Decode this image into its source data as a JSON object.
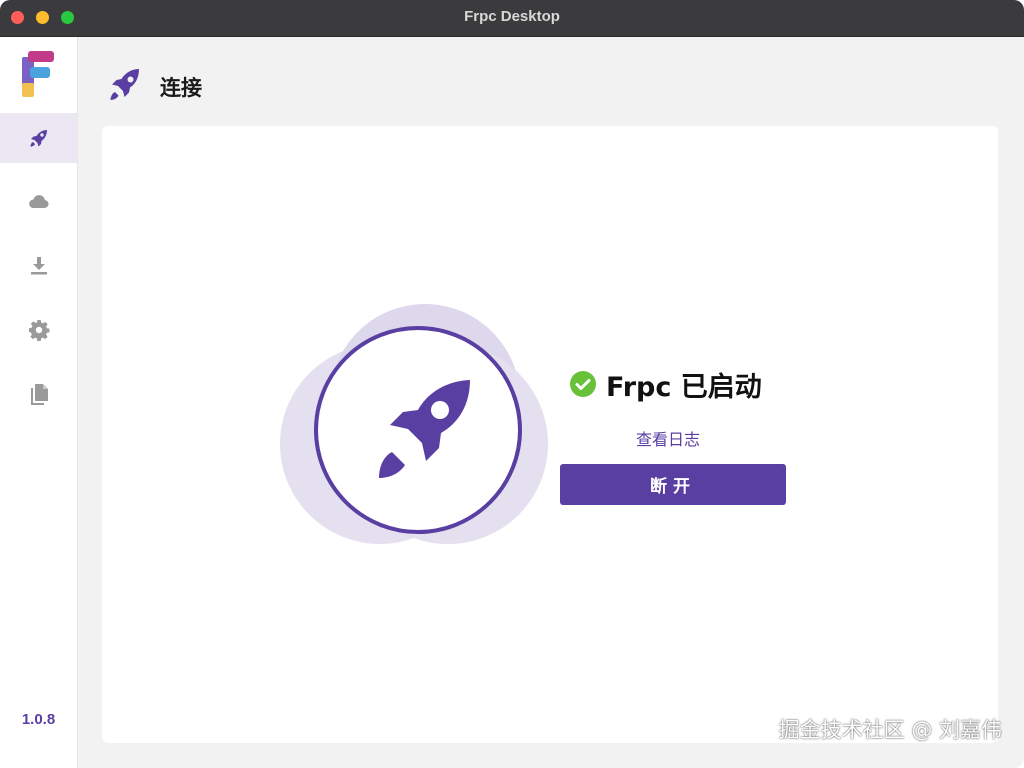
{
  "window": {
    "title": "Frpc Desktop"
  },
  "sidebar": {
    "items": [
      {
        "icon": "rocket-icon",
        "active": true
      },
      {
        "icon": "cloud-icon",
        "active": false
      },
      {
        "icon": "download-icon",
        "active": false
      },
      {
        "icon": "gear-icon",
        "active": false
      },
      {
        "icon": "documents-icon",
        "active": false
      }
    ],
    "version": "1.0.8"
  },
  "header": {
    "title": "连接",
    "icon": "rocket-icon"
  },
  "status": {
    "text": "Frpc 已启动",
    "icon": "check-circle-icon",
    "view_log_label": "查看日志",
    "disconnect_label": "断开"
  },
  "watermark": "掘金技术社区 @ 刘嘉伟",
  "colors": {
    "accent": "#5a3fa3",
    "accent_light": "#ddd8ec",
    "success": "#67c23a",
    "sidebar_active": "#ebe8f3"
  }
}
